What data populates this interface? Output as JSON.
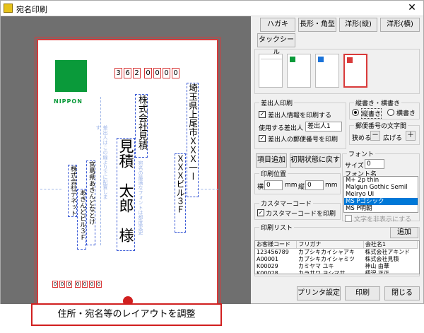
{
  "window": {
    "title": "宛名印刷",
    "close": "✕"
  },
  "preview": {
    "brand": "NIPPON",
    "zip": [
      "3",
      "6",
      "2",
      "0",
      "0",
      "0",
      "0"
    ],
    "address1": "埼玉県上尾市ＸＸＸ一ー",
    "address2": "ＸＸＸビル３Ｆ",
    "company": "株式会社見積",
    "name": "見積　太郎　様",
    "hint_recipient": "宛名の最適なフォントは都度変更",
    "hint_sender": "差出人はこの線より下に配置します",
    "sender_company": "株式会社デネット",
    "sender_address1": "宮島県あきんどなとけ",
    "sender_address2": "あきんどビル３Ｆ",
    "sender_zip": [
      "0",
      "0",
      "0",
      "0",
      "0",
      "0",
      "0"
    ]
  },
  "caption": "住所・宛名等のレイアウトを調整",
  "tabs": [
    "ハガキ",
    "長形・角型",
    "洋形(縦)",
    "洋形(横)",
    "タックシール"
  ],
  "sender": {
    "title": "差出人印刷",
    "print_info": "差出人情報を印刷する",
    "use_label": "使用する差出人",
    "use_value": "差出人1",
    "print_zip": "差出人の郵便番号を印刷"
  },
  "orientation": {
    "title": "縦書き・横書き",
    "vertical": "縦書き",
    "horizontal": "横書き"
  },
  "zip_spacing": {
    "title": "郵便番号の文字間",
    "narrow": "狭める",
    "minus": "－",
    "widen": "広げる",
    "plus": "＋"
  },
  "actions": {
    "add_item": "項目追加",
    "reset": "初期状態に戻す"
  },
  "print_pos": {
    "title": "印刷位置",
    "h_label": "横",
    "h_value": "0",
    "mm1": "mm",
    "v_label": "縦",
    "v_value": "0",
    "mm2": "mm"
  },
  "barcode": {
    "title": "カスタマーコード",
    "print": "カスタマーコードを印刷"
  },
  "font": {
    "title": "フォント",
    "size_label": "サイズ",
    "size_value": "0",
    "name_label": "フォント名",
    "names": [
      "M+ 2p thin",
      "Malgun Gothic Semil",
      "Meiryo UI",
      "MS Pゴシック",
      "MS P明朝"
    ],
    "selected": "MS Pゴシック",
    "hide_text": "文字を非表示にする"
  },
  "print_list": {
    "title": "印刷リスト",
    "add": "追加",
    "columns": [
      "お客様コード",
      "フリガナ",
      "会社名1"
    ],
    "rows": [
      [
        "123456789",
        "カブシキカイシャアキ",
        "株式会社アキンド"
      ],
      [
        "A00001",
        "カブシキカイシャミツ",
        "株式会社見積"
      ],
      [
        "K00029",
        "カミヤマ ユキ",
        "神山 由華"
      ],
      [
        "K00028",
        "カラサワ ヨシマサ",
        "柄沢 正正"
      ]
    ]
  },
  "footer": {
    "printer": "プリンタ設定",
    "print": "印刷",
    "close": "閉じる"
  }
}
